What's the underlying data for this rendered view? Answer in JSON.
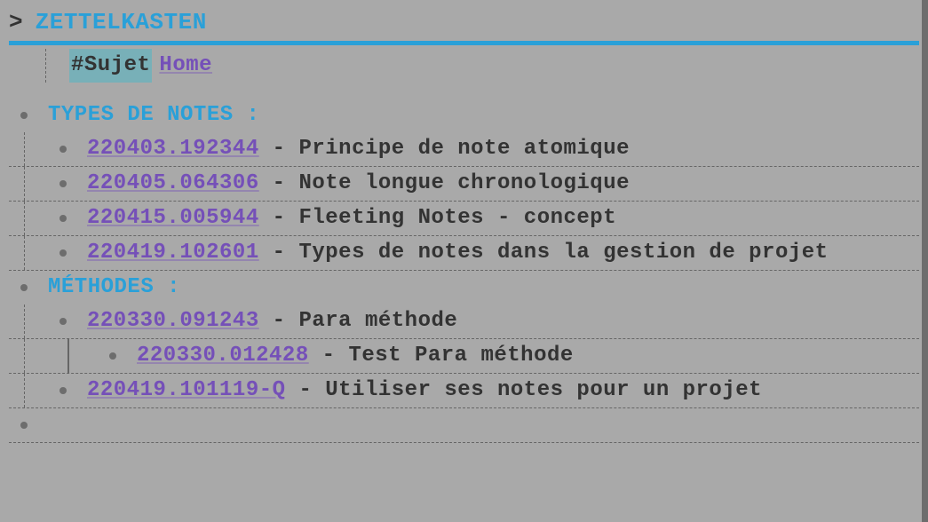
{
  "title": "ZETTELKASTEN",
  "tag": "#Sujet",
  "home": "Home",
  "sections": {
    "types": "TYPES DE NOTES :",
    "methodes": "MÉTHODES :"
  },
  "notes": {
    "n1": {
      "id": "220403.192344",
      "desc": "Principe de note atomique"
    },
    "n2": {
      "id": "220405.064306",
      "desc": "Note longue chronologique"
    },
    "n3": {
      "id": "220415.005944",
      "desc": "Fleeting Notes - concept"
    },
    "n4": {
      "id": "220419.102601",
      "desc": "Types de notes dans la gestion de projet"
    },
    "m1": {
      "id": "220330.091243",
      "desc": "Para méthode"
    },
    "m1a": {
      "id": "220330.012428",
      "desc": "Test Para méthode"
    },
    "m2": {
      "id": "220419.101119-Q",
      "desc": "Utiliser ses notes pour un projet"
    }
  },
  "sep": " - "
}
